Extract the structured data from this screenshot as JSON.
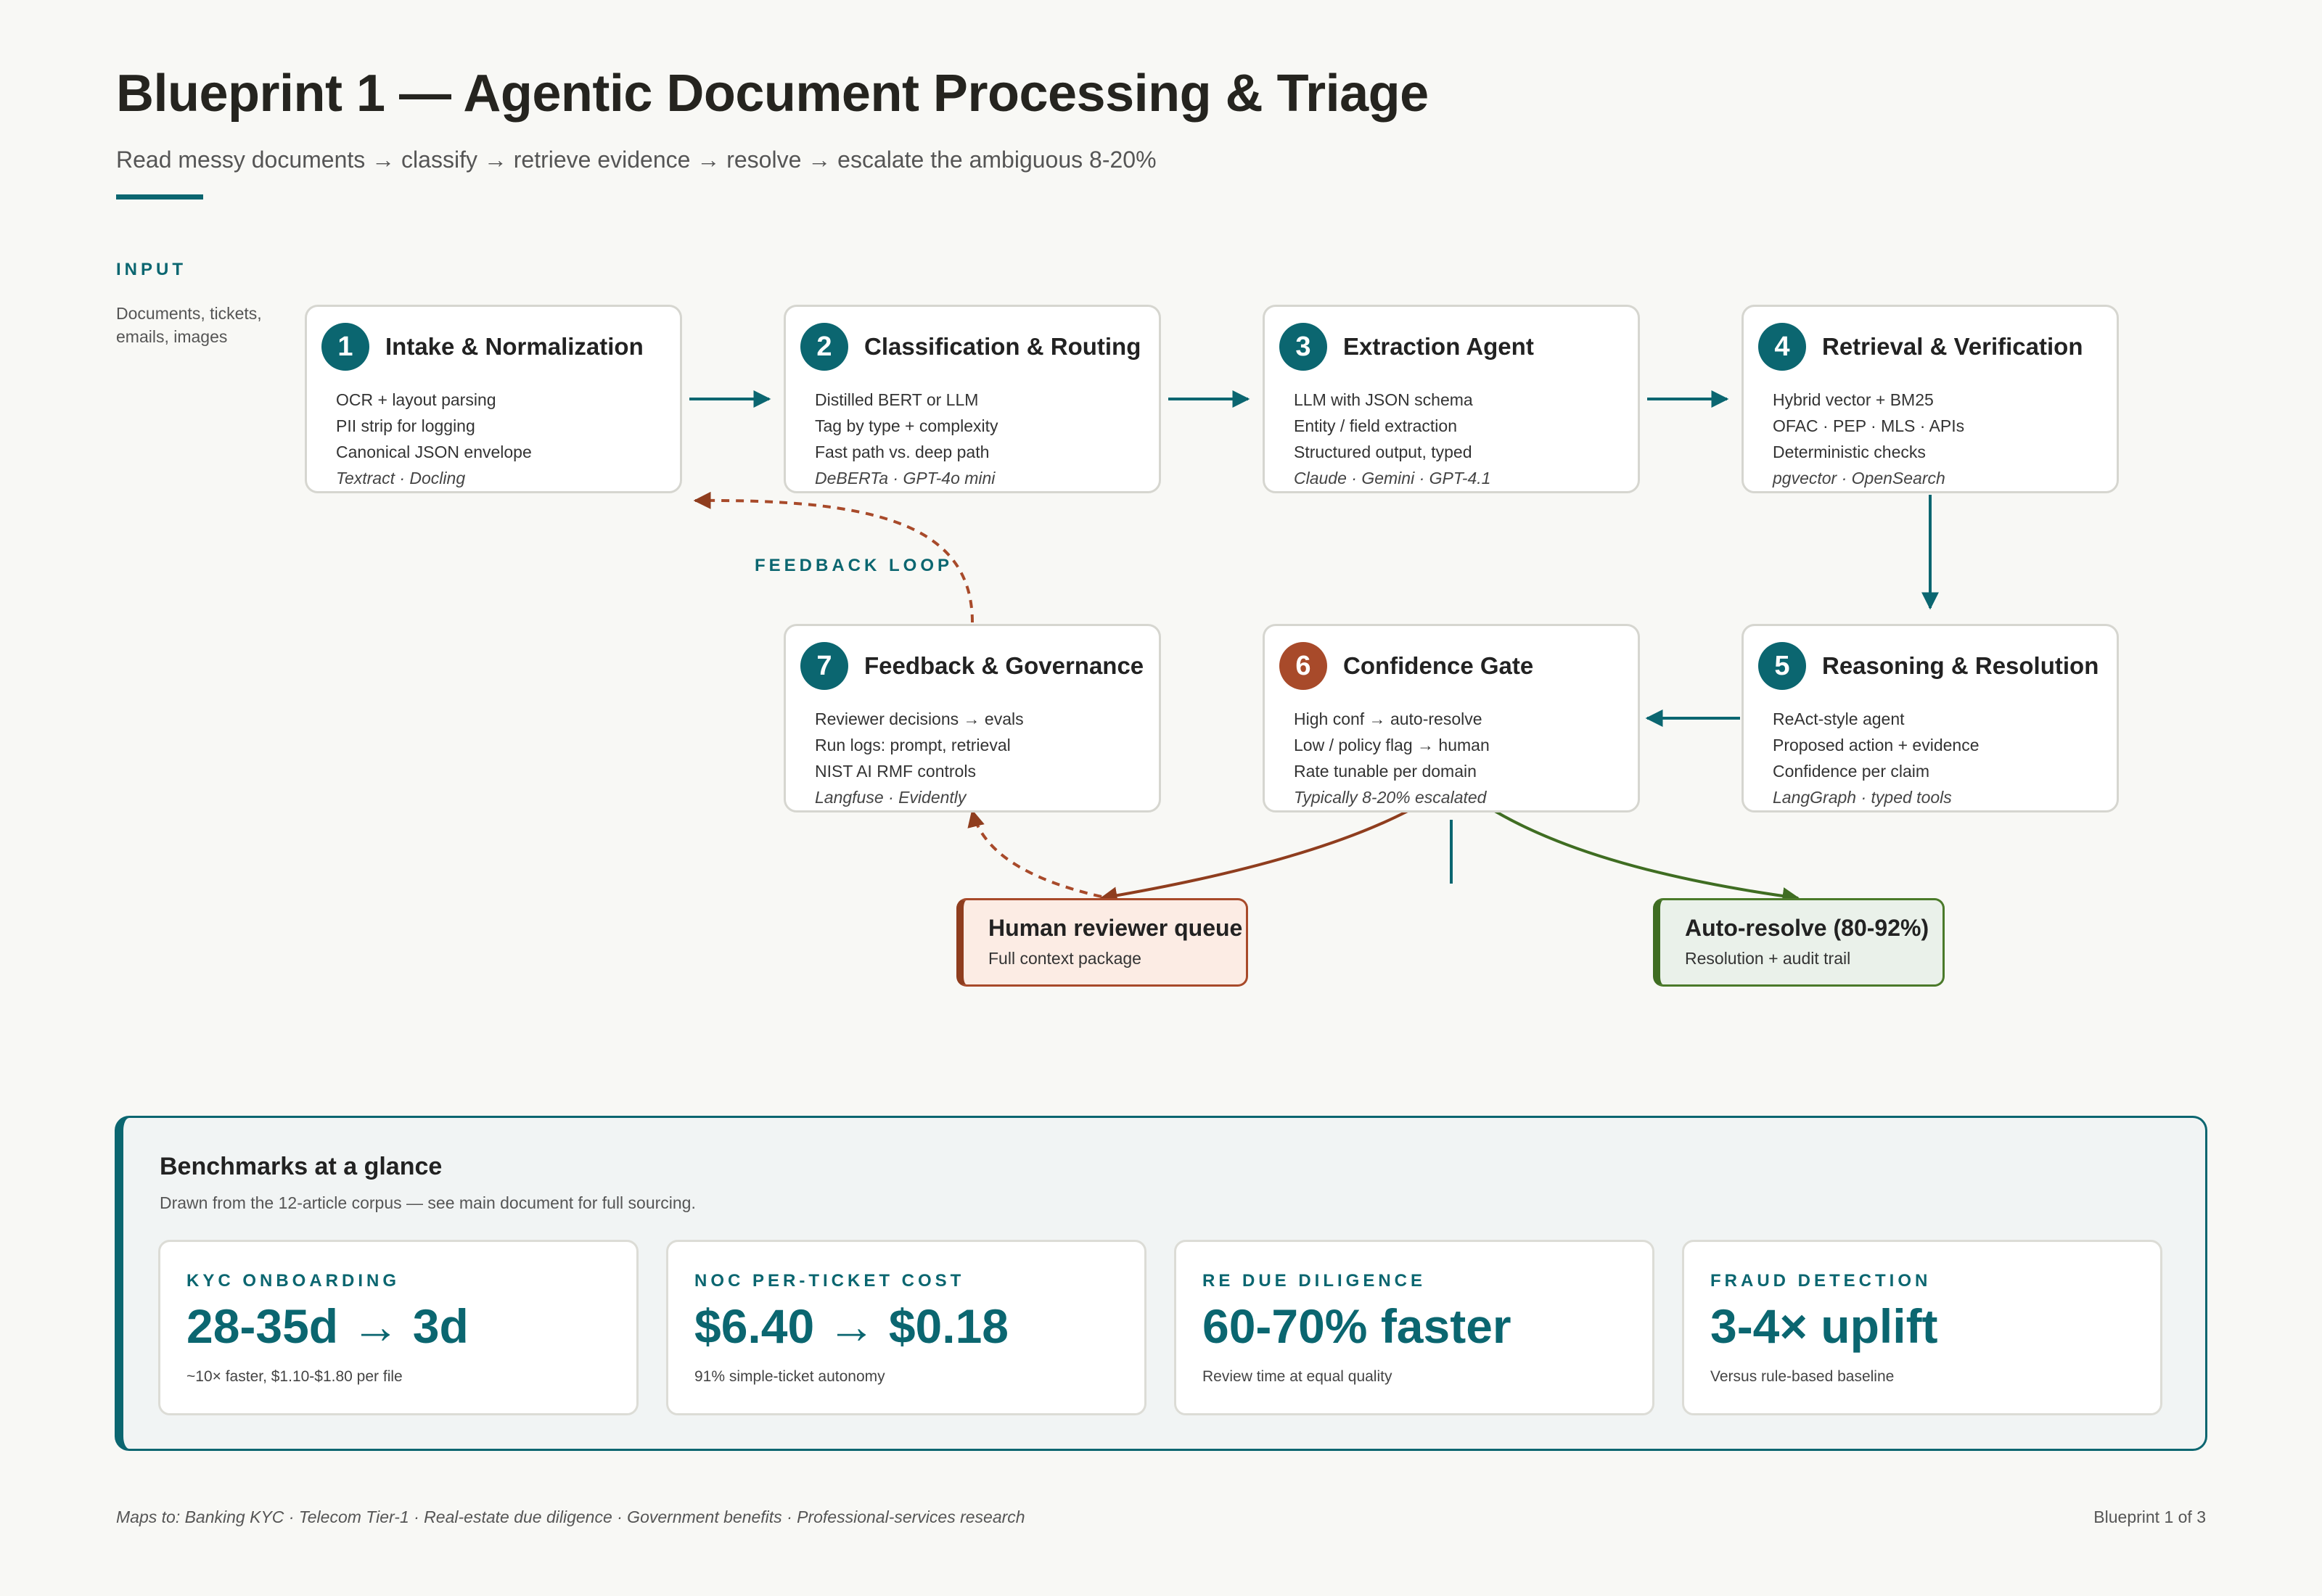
{
  "header": {
    "title": "Blueprint 1 — Agentic Document Processing & Triage",
    "subtitle": "Read messy documents → classify → retrieve evidence → resolve → escalate the ambiguous 8-20%"
  },
  "input": {
    "label": "INPUT",
    "desc": "Documents, tickets, emails, images"
  },
  "nodes": [
    {
      "num": "1",
      "title": "Intake & Normalization",
      "lines": [
        "OCR + layout parsing",
        "PII strip for logging",
        "Canonical JSON envelope"
      ],
      "tools": "Textract · Docling"
    },
    {
      "num": "2",
      "title": "Classification & Routing",
      "lines": [
        "Distilled BERT or LLM",
        "Tag by type + complexity",
        "Fast path vs. deep path"
      ],
      "tools": "DeBERTa · GPT-4o mini"
    },
    {
      "num": "3",
      "title": "Extraction Agent",
      "lines": [
        "LLM with JSON schema",
        "Entity / field extraction",
        "Structured output, typed"
      ],
      "tools": "Claude · Gemini · GPT-4.1"
    },
    {
      "num": "4",
      "title": "Retrieval & Verification",
      "lines": [
        "Hybrid vector + BM25",
        "OFAC · PEP · MLS · APIs",
        "Deterministic checks"
      ],
      "tools": "pgvector · OpenSearch"
    },
    {
      "num": "5",
      "title": "Reasoning & Resolution",
      "lines": [
        "ReAct-style agent",
        "Proposed action + evidence",
        "Confidence per claim"
      ],
      "tools": "LangGraph · typed tools"
    },
    {
      "num": "6",
      "title": "Confidence Gate",
      "lines": [
        "High conf → auto-resolve",
        "Low / policy flag → human",
        "Rate tunable per domain"
      ],
      "tools": "Typically 8-20% escalated"
    },
    {
      "num": "7",
      "title": "Feedback & Governance",
      "lines": [
        "Reviewer decisions → evals",
        "Run logs: prompt, retrieval",
        "NIST AI RMF controls"
      ],
      "tools": "Langfuse · Evidently"
    }
  ],
  "feedback_label": "FEEDBACK LOOP",
  "outcomes": {
    "human": {
      "title": "Human reviewer queue",
      "sub": "Full context package"
    },
    "auto": {
      "title": "Auto-resolve (80-92%)",
      "sub": "Resolution + audit trail"
    }
  },
  "benchmarks": {
    "title": "Benchmarks at a glance",
    "subtitle": "Drawn from the 12-article corpus — see main document for full sourcing.",
    "cards": [
      {
        "label": "KYC ONBOARDING",
        "value": "28-35d → 3d",
        "note": "~10× faster, $1.10-$1.80 per file"
      },
      {
        "label": "NOC PER-TICKET COST",
        "value": "$6.40 → $0.18",
        "note": "91% simple-ticket autonomy"
      },
      {
        "label": "RE DUE DILIGENCE",
        "value": "60-70% faster",
        "note": "Review time at equal quality"
      },
      {
        "label": "FRAUD DETECTION",
        "value": "3-4× uplift",
        "note": "Versus rule-based baseline"
      }
    ]
  },
  "footer": {
    "maps_to": "Maps to: Banking KYC · Telecom Tier-1 · Real-estate due diligence · Government benefits · Professional-services research",
    "page": "Blueprint 1 of 3"
  },
  "colors": {
    "teal": "#0b6670",
    "rust": "#a84a2a",
    "green": "#4b7a2a"
  }
}
